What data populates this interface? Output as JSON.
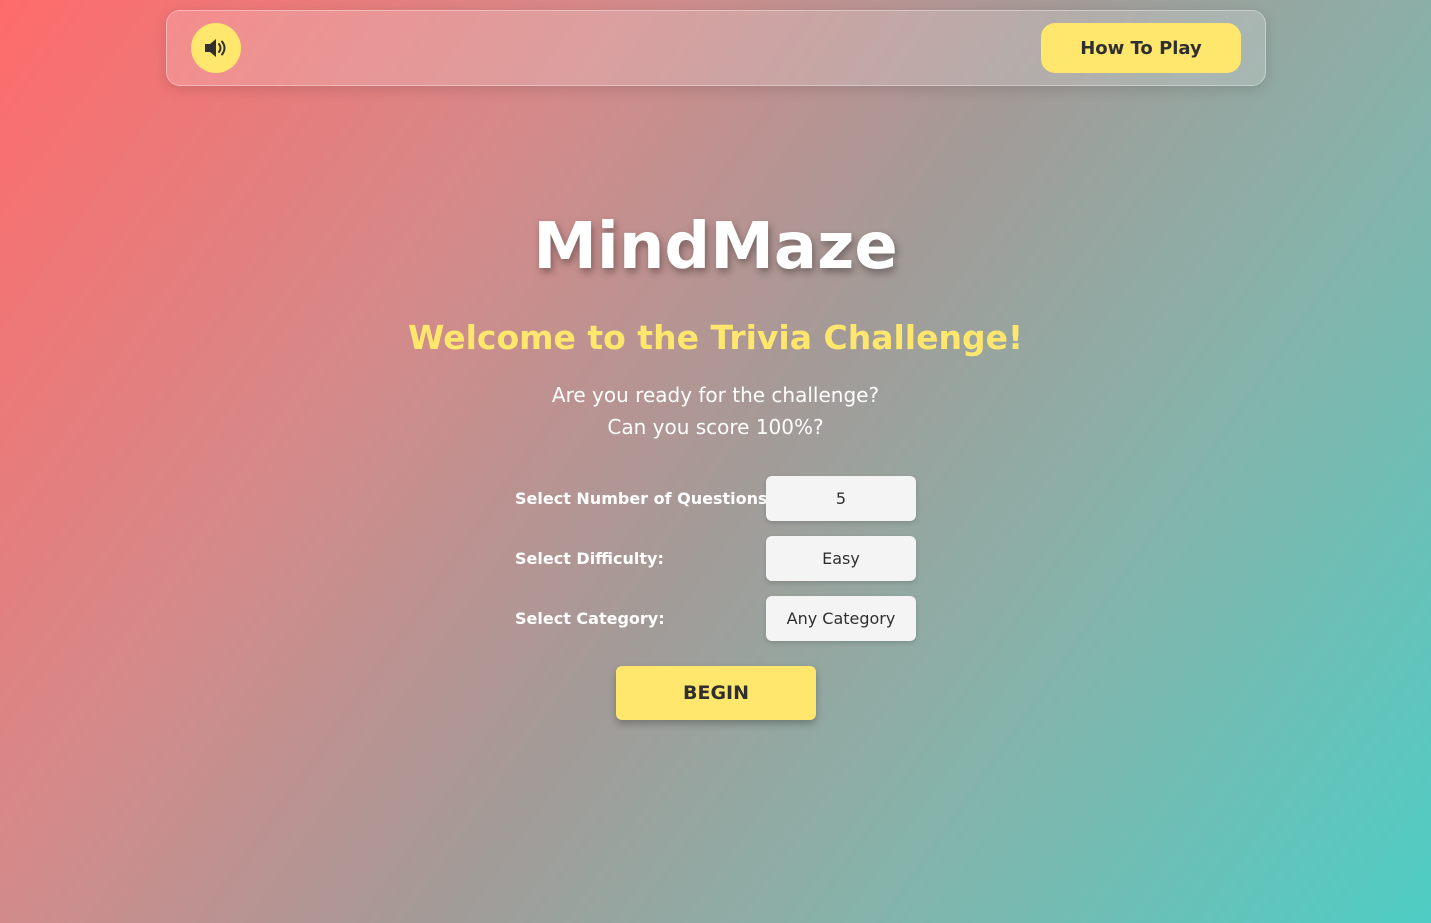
{
  "app": {
    "title": "MindMaze"
  },
  "topbar": {
    "sound_icon": "volume-high-icon",
    "how_to_play_label": "How To Play"
  },
  "main": {
    "welcome": "Welcome to the Trivia Challenge!",
    "tagline_line1": "Are you ready for the challenge?",
    "tagline_line2": "Can you score 100%?"
  },
  "settings": {
    "questions": {
      "label": "Select Number of Questions:",
      "value": "5"
    },
    "difficulty": {
      "label": "Select Difficulty:",
      "value": "Easy"
    },
    "category": {
      "label": "Select Category:",
      "value": "Any Category"
    }
  },
  "actions": {
    "begin_label": "BEGIN"
  },
  "colors": {
    "accent": "#ffe66d",
    "gradient_start": "#ff6b6b",
    "gradient_end": "#4ecdc4",
    "button_text": "#2f2f2f"
  }
}
